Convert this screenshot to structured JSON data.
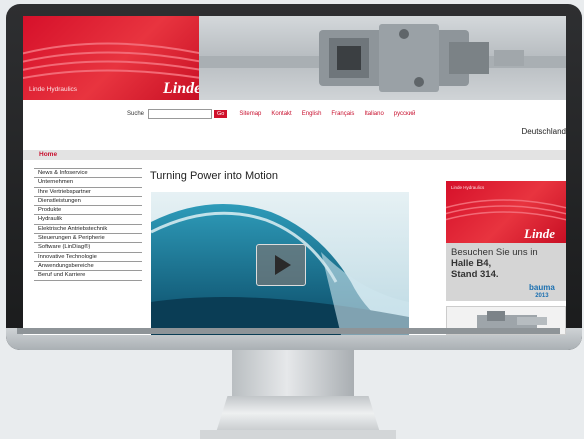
{
  "header": {
    "brand_small": "Linde Hydraulics",
    "logo": "Linde"
  },
  "topnav": {
    "search_label": "Suche",
    "search_placeholder": "",
    "go_label": "Go",
    "links": [
      "Sitemap",
      "Kontakt",
      "English",
      "Français",
      "Italiano",
      "русский"
    ]
  },
  "country": "Deutschland",
  "breadcrumb": "Home",
  "sidebar": {
    "items": [
      "News & Infoservice",
      "Unternehmen",
      "Ihre Vertriebspartner",
      "Dienstleistungen",
      "Produkte",
      "Hydraulik",
      "Elektrische Antriebstechnik",
      "Steuerungen & Peripherie",
      "Software (LinDiag®)",
      "Innovative Technologie",
      "Anwendungsbereiche",
      "Beruf und Karriere"
    ]
  },
  "main": {
    "title": "Turning Power into Motion"
  },
  "ad": {
    "brand_small": "Linde Hydraulics",
    "logo": "Linde",
    "line1": "Besuchen Sie uns in",
    "line2": "Halle B4,",
    "line3": "Stand 314.",
    "bauma": "bauma",
    "bauma_year": "2013"
  },
  "icons": {
    "play": "play-icon"
  },
  "colors": {
    "brand_red": "#d6102a",
    "link_red": "#c8102e"
  }
}
